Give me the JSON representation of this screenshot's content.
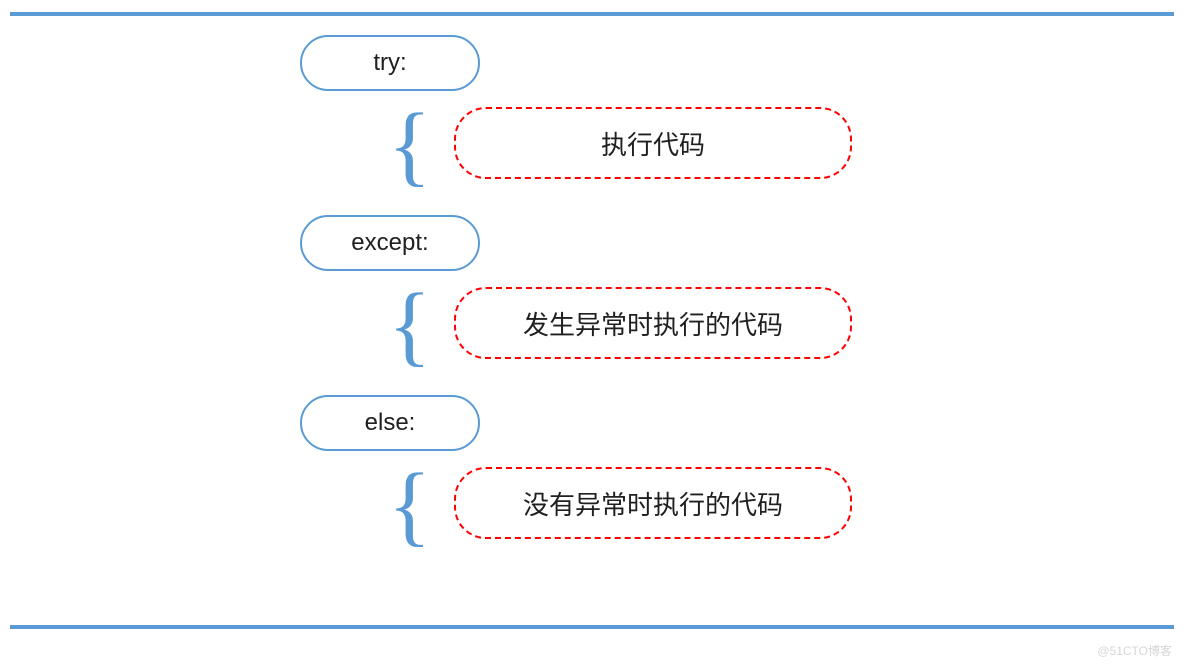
{
  "sections": [
    {
      "keyword": "try:",
      "description": "执行代码"
    },
    {
      "keyword": "except:",
      "description": "发生异常时执行的代码"
    },
    {
      "keyword": "else:",
      "description": "没有异常时执行的代码"
    }
  ],
  "watermark": "@51CTO博客"
}
